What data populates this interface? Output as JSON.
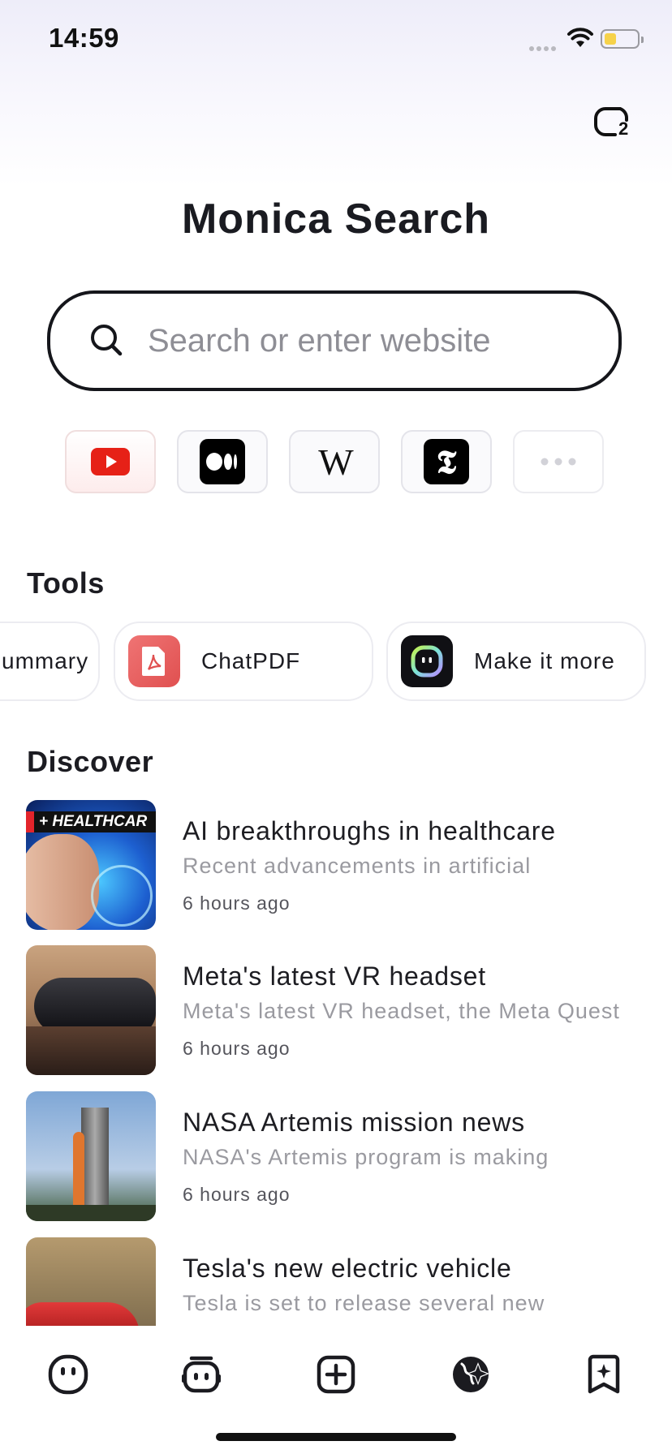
{
  "status_bar": {
    "time": "14:59"
  },
  "header": {
    "tab_count": "2",
    "title": "Monica Search"
  },
  "search": {
    "placeholder": "Search or enter website"
  },
  "shortcuts": [
    {
      "name": "YouTube",
      "icon": "youtube-icon"
    },
    {
      "name": "Medium",
      "icon": "medium-icon"
    },
    {
      "name": "Wikipedia",
      "icon": "wikipedia-icon"
    },
    {
      "name": "The New York Times",
      "icon": "nytimes-icon"
    },
    {
      "name": "More",
      "icon": "more-dots-icon"
    }
  ],
  "tools": {
    "heading": "Tools",
    "items": [
      {
        "label": "ummary",
        "icon": "summary-icon"
      },
      {
        "label": "ChatPDF",
        "icon": "pdf-icon"
      },
      {
        "label": "Make it more",
        "icon": "monica-bot-icon"
      }
    ]
  },
  "discover": {
    "heading": "Discover",
    "items": [
      {
        "title": "AI breakthroughs in healthcare",
        "snippet": "Recent advancements in artificial",
        "time": "6 hours ago",
        "thumb_text": "+ HEALTHCAR"
      },
      {
        "title": "Meta's latest VR headset",
        "snippet": "Meta's latest VR headset, the Meta Quest",
        "time": "6 hours ago"
      },
      {
        "title": "NASA Artemis mission news",
        "snippet": "NASA's Artemis program is making",
        "time": "6 hours ago"
      },
      {
        "title": "Tesla's new electric vehicle",
        "snippet": "Tesla is set to release several new",
        "time": ""
      }
    ]
  },
  "bottom_nav": [
    {
      "name": "chat",
      "icon": "monica-face-icon"
    },
    {
      "name": "bots",
      "icon": "bot-icon"
    },
    {
      "name": "new-tab",
      "icon": "plus-square-icon"
    },
    {
      "name": "search",
      "icon": "globe-search-icon",
      "active": true
    },
    {
      "name": "bookmarks",
      "icon": "bookmark-star-icon"
    }
  ],
  "colors": {
    "accent": "#15161b",
    "youtube_red": "#e62117",
    "pdf_red": "#e55b5b",
    "bot_ring": "#c6f34b"
  }
}
